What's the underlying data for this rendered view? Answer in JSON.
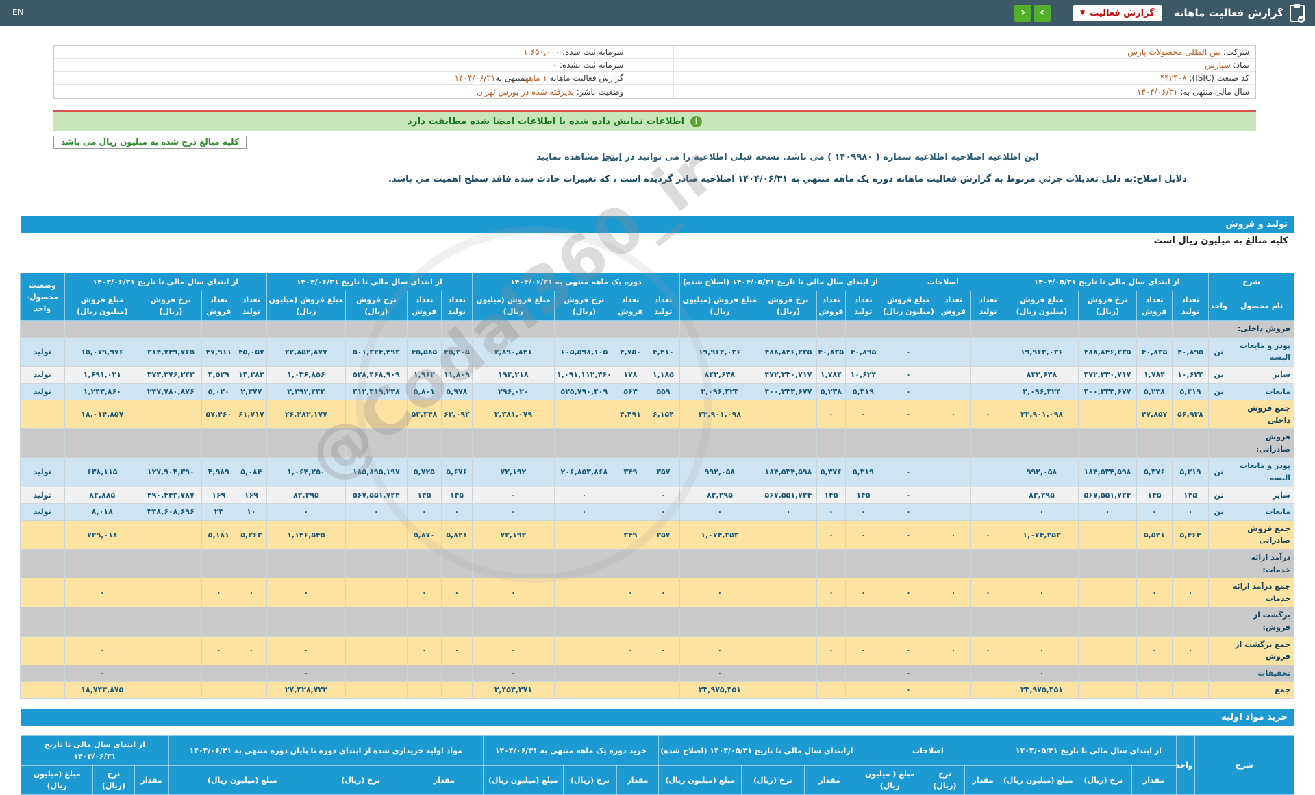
{
  "topbar": {
    "en_label": "EN",
    "title": "گزارش فعالیت ماهانه",
    "dropdown_label": "گزارش فعالیت",
    "dropdown_caret": "▼",
    "next_glyph": "›",
    "prev_glyph": "‹",
    "bar_color": "#3d5866",
    "nav_color": "#54b02b",
    "dropdown_text_color": "#c40808"
  },
  "info": {
    "rows": [
      {
        "r": [
          {
            "t": "شرکت:  ",
            "o": false
          },
          {
            "t": "بین المللی محصولات پارس",
            "o": true
          }
        ],
        "l": [
          {
            "t": "سرمایه ثبت شده:  ",
            "o": false
          },
          {
            "t": "۱,۶۵۰,۰۰۰",
            "o": true
          }
        ]
      },
      {
        "r": [
          {
            "t": "نماد:  ",
            "o": false
          },
          {
            "t": "شپارس",
            "o": true
          }
        ],
        "l": [
          {
            "t": "سرمایه ثبت نشده:  ",
            "o": false
          },
          {
            "t": "۰",
            "o": true
          }
        ]
      },
      {
        "r": [
          {
            "t": "کد صنعت (ISIC):  ",
            "o": false
          },
          {
            "t": "۴۴۲۴۰۸",
            "o": true
          }
        ],
        "l": [
          {
            "t": "گزارش فعالیت ماهانه ",
            "o": false
          },
          {
            "t": "۱ ماهه",
            "o": true
          },
          {
            "t": "منتهی به",
            "o": false
          },
          {
            "t": "۱۴۰۴/۰۶/۳۱",
            "o": true
          }
        ]
      },
      {
        "r": [
          {
            "t": "سال مالی منتهی به:  ",
            "o": false
          },
          {
            "t": "۱۴۰۴/۰۶/۳۱",
            "o": true
          }
        ],
        "l": [
          {
            "t": "وضعیت ناشر:  ",
            "o": false
          },
          {
            "t": "پذیرفته شده در بورس تهران",
            "o": true
          }
        ]
      }
    ]
  },
  "notice": {
    "icon_glyph": "i",
    "text": "اطلاعات نمایش داده شده با اطلاعات امضا شده مطابقت دارد",
    "bg": "#c8e5bc",
    "top_line": "#e0514e"
  },
  "amounts_box": "کلیه مبالغ درج شده به میلیون ریال می باشد",
  "para1": {
    "before": "این اطلاعیه اصلاحیه اطلاعیه شماره ( ۱۴۰۹۹۸۰ ) می باشد. نسخه قبلی اطلاعیه را می توانید در ",
    "link": "اینجا",
    "after": " مشاهده نمایید"
  },
  "para2": "دلایل اصلاح:به دلیل تعدیلات جزئي مربوط به گزارش فعالیت ماهانه دوره یک ماهه منتهي به ۱۴۰۴/۰۶/۳۱ اصلاحیه صادر گردیده است ، که تغییرات حادث شده فاقد سطح اهمیت مي باشد.",
  "watermark": "@Codal360_ir",
  "section1": {
    "title": "تولید و فروش",
    "subtitle": "کلیه مبالغ به میلیون ریال است",
    "accent": "#1e9ad3"
  },
  "production_table": {
    "desc_header": "شرح",
    "name_header": "نام محصول",
    "unit_header": "واحد",
    "status_header": "وضعیت محصول-واحد",
    "groups": [
      {
        "label": "از ابتدای سال مالی تا تاریخ ۱۴۰۴/۰۵/۳۱",
        "cols": [
          "تعداد تولید",
          "تعداد فروش",
          "نرخ فروش (ریال)",
          "مبلغ فروش (میلیون ریال)"
        ]
      },
      {
        "label": "اصلاحات",
        "cols": [
          "تعداد تولید",
          "تعداد فروش",
          "مبلغ فروش (میلیون ریال)"
        ]
      },
      {
        "label": "از ابتدای سال مالی تا تاریخ ۱۴۰۴/۰۵/۳۱ (اصلاح شده)",
        "cols": [
          "تعداد تولید",
          "تعداد فروش",
          "نرخ فروش (ریال)",
          "مبلغ فروش (میلیون ریال)"
        ]
      },
      {
        "label": "دوره یک ماهه منتهی به ۱۴۰۴/۰۶/۳۱",
        "cols": [
          "تعداد تولید",
          "تعداد فروش",
          "نرخ فروش (ریال)",
          "مبلغ فروش (میلیون ریال)"
        ]
      },
      {
        "label": "از ابتدای سال مالی تا تاریخ ۱۴۰۴/۰۶/۳۱",
        "cols": [
          "تعداد تولید",
          "تعداد فروش",
          "نرخ فروش (ریال)",
          "مبلغ فروش (میلیون ریال)"
        ]
      },
      {
        "label": "از ابتدای سال مالی تا تاریخ ۱۴۰۳/۰۶/۳۱",
        "cols": [
          "تعداد تولید",
          "تعداد فروش",
          "نرخ فروش (ریال)",
          "مبلغ فروش (میلیون ریال)"
        ]
      }
    ],
    "rows": [
      {
        "kind": "section",
        "name": "فروش داخلی:"
      },
      {
        "kind": "data",
        "name": "پودر و مایعات البسه",
        "unit": "تن",
        "status": "تولید",
        "g1": [
          "۴۰,۸۹۵",
          "۴۰,۸۳۵",
          "۴۸۸,۸۴۶,۲۳۵",
          "۱۹,۹۶۲,۰۳۶"
        ],
        "g2": [
          "",
          "",
          "۰"
        ],
        "g3": [
          "۴۰,۸۹۵",
          "۴۰,۸۳۵",
          "۴۸۸,۸۴۶,۲۳۵",
          "۱۹,۹۶۲,۰۳۶"
        ],
        "g4": [
          "۴,۴۱۰",
          "۴,۷۵۰",
          "۶۰۵,۵۹۸,۱۰۵",
          "۲,۸۹۰,۸۴۱"
        ],
        "g5": [
          "۴۵,۳۰۵",
          "۴۵,۵۸۵",
          "۵۰۱,۳۲۴,۴۹۳",
          "۲۲,۸۵۲,۸۷۷"
        ],
        "g6": [
          "۴۵,۰۵۷",
          "۴۷,۹۱۱",
          "۳۱۴,۷۴۹,۷۶۵",
          "۱۵,۰۷۹,۹۷۶"
        ]
      },
      {
        "kind": "data",
        "name": "سایر",
        "unit": "تن",
        "status": "تولید",
        "g1": [
          "۱۰,۶۲۴",
          "۱,۷۸۴",
          "۴۷۲,۳۳۰,۷۱۷",
          "۸۴۲,۶۳۸"
        ],
        "g2": [
          "",
          "",
          "۰"
        ],
        "g3": [
          "۱۰,۶۲۴",
          "۱,۷۸۴",
          "۴۷۲,۳۳۰,۷۱۷",
          "۸۴۲,۶۳۸"
        ],
        "g4": [
          "۱,۱۸۵",
          "۱۷۸",
          "۱,۰۹۱,۱۱۲,۳۶۰",
          "۱۹۴,۲۱۸"
        ],
        "g5": [
          "۱۱,۸۰۹",
          "۱,۹۶۲",
          "۵۲۸,۴۶۸,۹۰۹",
          "۱,۰۳۶,۸۵۶"
        ],
        "g6": [
          "۱۴,۲۸۳",
          "۴,۵۲۹",
          "۳۷۳,۳۷۶,۲۴۲",
          "۱,۶۹۱,۰۲۱"
        ]
      },
      {
        "kind": "data",
        "name": "مایعات",
        "unit": "تن",
        "status": "تولید",
        "g1": [
          "۵,۴۱۹",
          "۵,۲۳۸",
          "۴۰۰,۲۳۳,۶۷۷",
          "۲,۰۹۶,۴۲۴"
        ],
        "g2": [
          "",
          "",
          "۰"
        ],
        "g3": [
          "۵,۴۱۹",
          "۵,۲۳۸",
          "۴۰۰,۲۳۳,۶۷۷",
          "۲,۰۹۶,۴۲۴"
        ],
        "g4": [
          "۵۵۹",
          "۵۶۳",
          "۵۲۵,۷۹۰,۴۰۹",
          "۲۹۶,۰۲۰"
        ],
        "g5": [
          "۵,۹۷۸",
          "۵,۸۰۱",
          "۴۱۲,۴۱۹,۲۳۸",
          "۲,۳۹۲,۴۴۴"
        ],
        "g6": [
          "۲,۳۷۷",
          "۵,۰۲۰",
          "۲۴۷,۷۸۰,۸۷۶",
          "۱,۲۴۳,۸۶۰"
        ]
      },
      {
        "kind": "total",
        "name": "جمع فروش داخلی",
        "unit": "",
        "status": "",
        "g1": [
          "۵۶,۹۳۸",
          "۴۷,۸۵۷",
          "",
          "۲۲,۹۰۱,۰۹۸"
        ],
        "g2": [
          "۰",
          "۰",
          "۰"
        ],
        "g3": [
          "۰",
          "۰",
          "",
          "۲۲,۹۰۱,۰۹۸"
        ],
        "g4": [
          "۶,۱۵۴",
          "۴,۴۹۱",
          "",
          "۳,۳۸۱,۰۷۹"
        ],
        "g5": [
          "۶۳,۰۹۲",
          "۵۳,۳۴۸",
          "",
          "۲۶,۲۸۲,۱۷۷"
        ],
        "g6": [
          "۶۱,۷۱۷",
          "۵۷,۴۶۰",
          "",
          "۱۸,۰۱۴,۸۵۷"
        ]
      },
      {
        "kind": "section",
        "name": "فروش صادراتی:"
      },
      {
        "kind": "data",
        "name": "پودر و مایعات البسه",
        "unit": "تن",
        "status": "تولید",
        "g1": [
          "۵,۳۱۹",
          "۵,۳۷۶",
          "۱۸۴,۵۳۴,۵۹۸",
          "۹۹۲,۰۵۸"
        ],
        "g2": [
          "",
          "",
          "۰"
        ],
        "g3": [
          "۵,۳۱۹",
          "۵,۳۷۶",
          "۱۸۴,۵۳۴,۵۹۸",
          "۹۹۲,۰۵۸"
        ],
        "g4": [
          "۳۵۷",
          "۳۴۹",
          "۲۰۶,۸۵۳,۸۶۸",
          "۷۲,۱۹۲"
        ],
        "g5": [
          "۵,۶۷۶",
          "۵,۷۲۵",
          "۱۸۵,۸۹۵,۱۹۷",
          "۱,۰۶۴,۲۵۰"
        ],
        "g6": [
          "۵,۰۸۴",
          "۴,۹۸۹",
          "۱۲۷,۹۰۴,۳۹۰",
          "۶۳۸,۱۱۵"
        ]
      },
      {
        "kind": "data",
        "name": "سایر",
        "unit": "تن",
        "status": "تولید",
        "g1": [
          "۱۴۵",
          "۱۴۵",
          "۵۶۷,۵۵۱,۷۲۴",
          "۸۲,۲۹۵"
        ],
        "g2": [
          "",
          "",
          "۰"
        ],
        "g3": [
          "۱۴۵",
          "۱۴۵",
          "۵۶۷,۵۵۱,۷۲۴",
          "۸۲,۲۹۵"
        ],
        "g4": [
          "۰",
          "",
          "۰",
          "۰"
        ],
        "g5": [
          "۱۴۵",
          "۱۴۵",
          "۵۶۷,۵۵۱,۷۲۴",
          "۸۲,۲۹۵"
        ],
        "g6": [
          "۱۶۹",
          "۱۶۹",
          "۴۹۰,۴۴۳,۷۸۷",
          "۸۲,۸۸۵"
        ]
      },
      {
        "kind": "data",
        "name": "مایعات",
        "unit": "تن",
        "status": "تولید",
        "g1": [
          "۰",
          "۰",
          "۰",
          "۰"
        ],
        "g2": [
          "",
          "",
          "۰"
        ],
        "g3": [
          "۰",
          "۰",
          "۰",
          "۰"
        ],
        "g4": [
          "۰",
          "",
          "۰",
          "۰"
        ],
        "g5": [
          "۰",
          "۰",
          "۰",
          "۰"
        ],
        "g6": [
          "۱۰",
          "۲۳",
          "۳۴۸,۶۰۸,۶۹۶",
          "۸,۰۱۸"
        ]
      },
      {
        "kind": "total",
        "name": "جمع فروش صادراتی",
        "unit": "",
        "status": "",
        "g1": [
          "۵,۴۶۴",
          "۵,۵۲۱",
          "",
          "۱,۰۷۴,۳۵۳"
        ],
        "g2": [
          "۰",
          "۰",
          "۰"
        ],
        "g3": [
          "۰",
          "۰",
          "",
          "۱,۰۷۴,۳۵۳"
        ],
        "g4": [
          "۳۵۷",
          "۳۴۹",
          "",
          "۷۲,۱۹۲"
        ],
        "g5": [
          "۵,۸۲۱",
          "۵,۸۷۰",
          "",
          "۱,۱۴۶,۵۴۵"
        ],
        "g6": [
          "۵,۲۶۳",
          "۵,۱۸۱",
          "",
          "۷۲۹,۰۱۸"
        ]
      },
      {
        "kind": "section",
        "name": "درآمد ارائه خدمات:"
      },
      {
        "kind": "total",
        "name": "جمع درآمد ارائه خدمات",
        "unit": "",
        "status": "",
        "g1": [
          "۰",
          "۰",
          "",
          "۰"
        ],
        "g2": [
          "۰",
          "۰",
          "۰"
        ],
        "g3": [
          "۰",
          "۰",
          "",
          "۰"
        ],
        "g4": [
          "۰",
          "۰",
          "",
          "۰"
        ],
        "g5": [
          "۰",
          "۰",
          "",
          "۰"
        ],
        "g6": [
          "۰",
          "۰",
          "",
          "۰"
        ]
      },
      {
        "kind": "section",
        "name": "برگشت از فروش:"
      },
      {
        "kind": "total",
        "name": "جمع برگشت از فروش",
        "unit": "",
        "status": "",
        "g1": [
          "۰",
          "۰",
          "",
          "۰"
        ],
        "g2": [
          "۰",
          "۰",
          "۰"
        ],
        "g3": [
          "۰",
          "۰",
          "",
          "۰"
        ],
        "g4": [
          "۰",
          "۰",
          "",
          "۰"
        ],
        "g5": [
          "۰",
          "۰",
          "",
          "۰"
        ],
        "g6": [
          "۰",
          "۰",
          "",
          "۰"
        ]
      },
      {
        "kind": "discount",
        "name": "تخفیفات",
        "unit": "",
        "status": "",
        "g1": [
          "",
          "",
          "",
          "۰"
        ],
        "g2": [
          "",
          "",
          "۰"
        ],
        "g3": [
          "",
          "",
          "",
          "۰"
        ],
        "g4": [
          "",
          "",
          "",
          "۰"
        ],
        "g5": [
          "",
          "",
          "",
          "۰"
        ],
        "g6": [
          "",
          "",
          "",
          "۰"
        ]
      },
      {
        "kind": "total",
        "name": "جمع",
        "unit": "",
        "status": "",
        "g1": [
          "",
          "",
          "",
          "۲۳,۹۷۵,۴۵۱"
        ],
        "g2": [
          "",
          "",
          "۰"
        ],
        "g3": [
          "",
          "",
          "",
          "۲۳,۹۷۵,۴۵۱"
        ],
        "g4": [
          "",
          "",
          "",
          "۳,۴۵۳,۲۷۱"
        ],
        "g5": [
          "",
          "",
          "",
          "۲۷,۴۲۸,۷۲۲"
        ],
        "g6": [
          "",
          "",
          "",
          "۱۸,۷۴۳,۸۷۵"
        ]
      }
    ]
  },
  "section2": {
    "title": "خرید مواد اولیه"
  },
  "purchase_table": {
    "desc_header": "شرح",
    "unit_header": "واحد",
    "groups": [
      {
        "label": "از ابتدای سال مالی تا تاریخ ۱۴۰۴/۰۵/۳۱",
        "cols": [
          "مقدار",
          "نرخ (ریال)",
          "مبلغ (میلیون ریال)"
        ]
      },
      {
        "label": "اصلاحات",
        "cols": [
          "مقدار",
          "نرخ (ریال)",
          "مبلغ ( میلیون ریال)"
        ]
      },
      {
        "label": "ازابتدای سال مالی تا تاریخ ۱۴۰۴/۰۵/۳۱ (اصلاح شده)",
        "cols": [
          "مقدار",
          "نرخ (ریال)",
          "مبلغ (میلیون ریال)"
        ]
      },
      {
        "label": "خرید دوره یک ماهه منتهی به ۱۴۰۴/۰۶/۳۱",
        "cols": [
          "مقدار",
          "نرخ (ریال)",
          "مبلغ (میلیون ریال)"
        ]
      },
      {
        "label": "مواد اولیه خریداری شده از ابتدای دوره تا پایان دوره منتهی به ۱۴۰۴/۰۶/۳۱",
        "cols": [
          "مقدار",
          "نرخ (ریال)",
          "مبلغ (میلیون ریال)"
        ]
      },
      {
        "label": "از ابتدای سال مالی تا تاریخ ۱۴۰۳/۰۶/۳۱",
        "cols": [
          "مقدار",
          "نرخ (ریال)",
          "مبلغ (میلیون ریال)"
        ]
      }
    ]
  }
}
